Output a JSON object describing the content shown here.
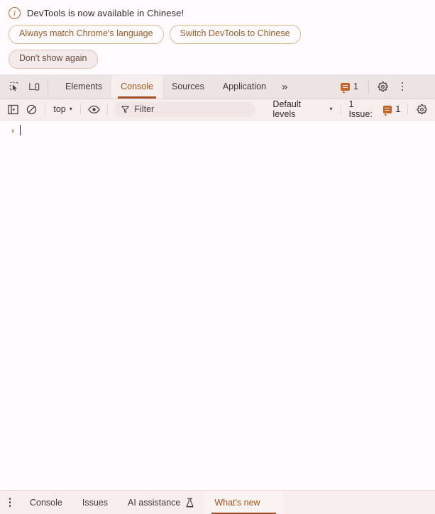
{
  "banner": {
    "icon": "info-icon",
    "message": "DevTools is now available in Chinese!",
    "buttons": [
      {
        "label": "Always match Chrome's language",
        "style": "outline"
      },
      {
        "label": "Switch DevTools to Chinese",
        "style": "outline"
      },
      {
        "label": "Don't show again",
        "style": "filled"
      }
    ],
    "close_icon": "close-icon"
  },
  "tabbar": {
    "inspect_icon": "inspect-element-icon",
    "device_icon": "device-toolbar-icon",
    "tabs": [
      {
        "label": "Elements",
        "active": false
      },
      {
        "label": "Console",
        "active": true
      },
      {
        "label": "Sources",
        "active": false
      },
      {
        "label": "Application",
        "active": false
      }
    ],
    "more_tabs_label": "»",
    "issues_icon": "issues-message-icon",
    "issues_count": "1",
    "settings_icon": "gear-icon",
    "more_options_icon": "kebab-menu-icon",
    "close_icon": "close-icon"
  },
  "filterbar": {
    "sidebar_icon": "console-sidebar-icon",
    "clear_icon": "clear-console-icon",
    "context": "top",
    "context_caret": "▾",
    "eye_icon": "live-expression-icon",
    "filter_icon": "filter-funnel-icon",
    "filter_value": "",
    "filter_placeholder": "Filter",
    "levels_label": "Default levels",
    "levels_caret": "▾",
    "issue_label": "1 Issue:",
    "issue_icon": "issues-message-icon",
    "issue_count": "1",
    "settings_icon": "console-settings-gear-icon"
  },
  "console": {
    "prompt_arrow": "›",
    "input_value": ""
  },
  "drawer": {
    "more_icon": "kebab-menu-icon",
    "tabs": [
      {
        "label": "Console",
        "active": false,
        "icon": null,
        "closable": false
      },
      {
        "label": "Issues",
        "active": false,
        "icon": null,
        "closable": false
      },
      {
        "label": "AI assistance",
        "active": false,
        "icon": "experiment-flask-icon",
        "closable": false
      },
      {
        "label": "What's new",
        "active": true,
        "icon": null,
        "closable": true
      }
    ],
    "close_icon": "close-icon"
  },
  "colors": {
    "accent": "#a0522a",
    "banner_button_border": "#e3b896",
    "tabbar_bg": "#ece4e2",
    "panel_bg": "#fffbfe",
    "toolbar_bg": "#f6eeec",
    "issue_orange": "#c4652a"
  }
}
